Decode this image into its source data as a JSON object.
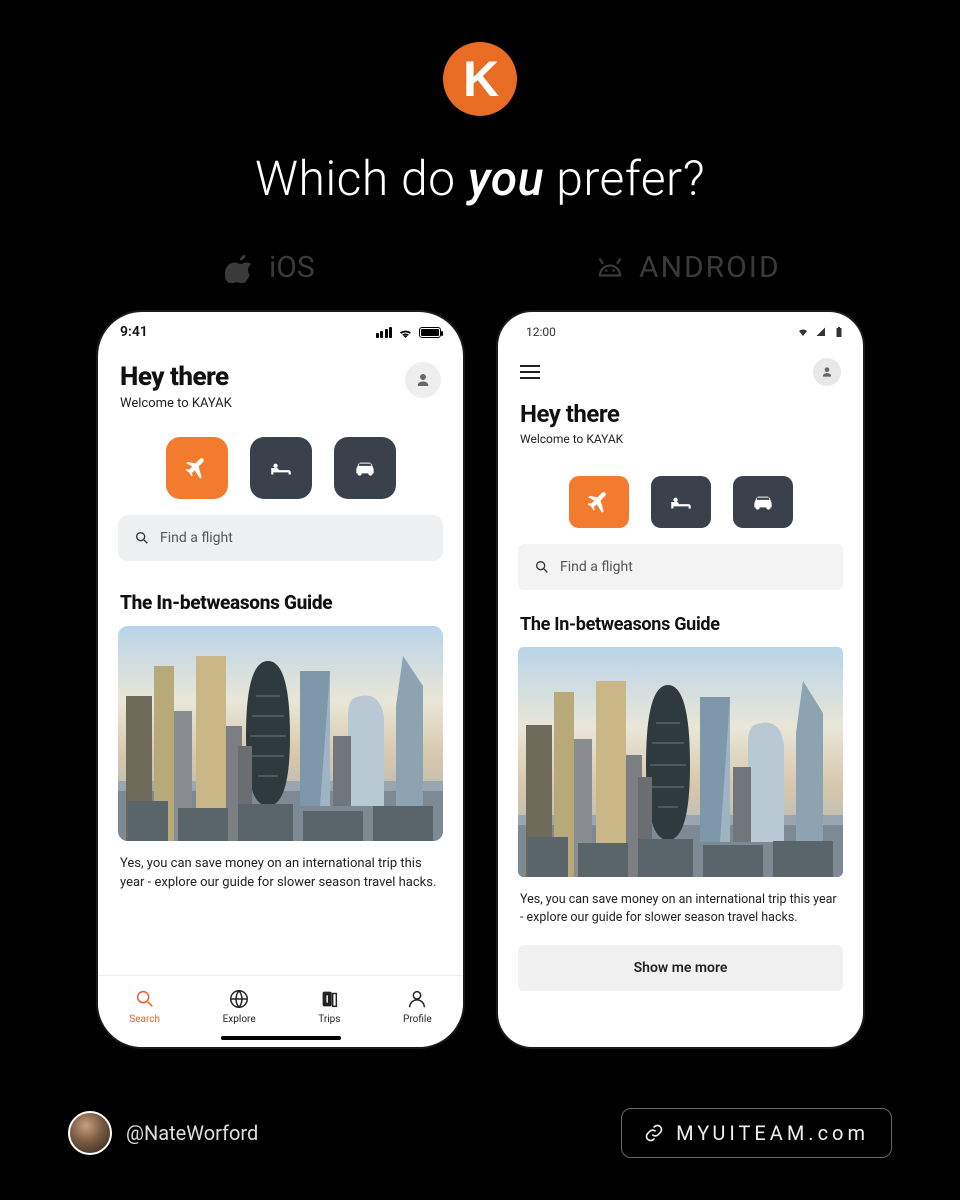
{
  "logo_letter": "K",
  "headline_pre": "Which do ",
  "headline_em": "you",
  "headline_post": " prefer?",
  "platforms": {
    "ios": "iOS",
    "android": "ANDROID"
  },
  "status": {
    "ios_time": "9:41",
    "android_time": "12:00"
  },
  "greeting": {
    "title": "Hey there",
    "subtitle": "Welcome to KAYAK"
  },
  "categories": {
    "flights": "flights",
    "stays": "stays",
    "cars": "cars"
  },
  "search": {
    "placeholder": "Find a flight"
  },
  "guide": {
    "title": "The In-betweasons Guide",
    "blurb_ios": "Yes, you can save money on an international trip this year - explore our guide for slower season travel hacks.",
    "blurb_android": "Yes, you can save money on an international trip this year - explore our guide for slower season travel hacks."
  },
  "tabs": {
    "search": "Search",
    "explore": "Explore",
    "trips": "Trips",
    "profile": "Profile"
  },
  "cta": {
    "show_more": "Show me more"
  },
  "footer": {
    "handle": "@NateWorford",
    "site": "MYUITEAM.com"
  },
  "colors": {
    "accent": "#f27b2e",
    "dark_tile": "#3a414a"
  }
}
